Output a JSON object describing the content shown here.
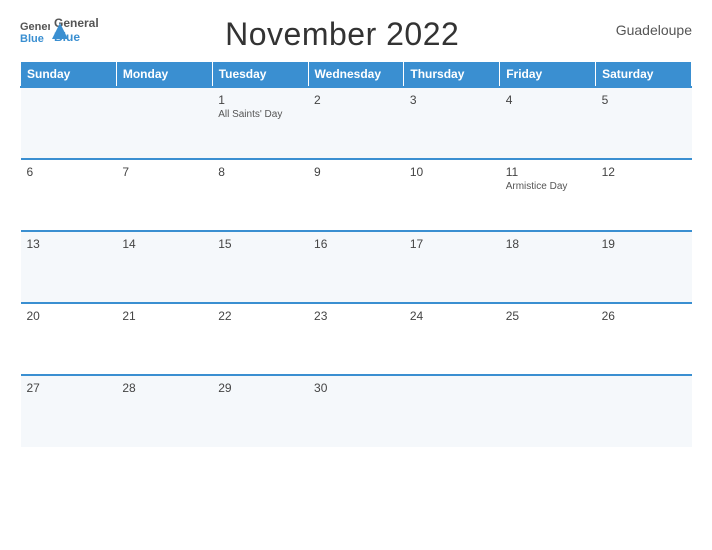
{
  "logo": {
    "line1": "General",
    "line2": "Blue"
  },
  "title": "November 2022",
  "country": "Guadeloupe",
  "days": [
    "Sunday",
    "Monday",
    "Tuesday",
    "Wednesday",
    "Thursday",
    "Friday",
    "Saturday"
  ],
  "weeks": [
    [
      {
        "date": "",
        "holiday": ""
      },
      {
        "date": "",
        "holiday": ""
      },
      {
        "date": "1",
        "holiday": "All Saints' Day"
      },
      {
        "date": "2",
        "holiday": ""
      },
      {
        "date": "3",
        "holiday": ""
      },
      {
        "date": "4",
        "holiday": ""
      },
      {
        "date": "5",
        "holiday": ""
      }
    ],
    [
      {
        "date": "6",
        "holiday": ""
      },
      {
        "date": "7",
        "holiday": ""
      },
      {
        "date": "8",
        "holiday": ""
      },
      {
        "date": "9",
        "holiday": ""
      },
      {
        "date": "10",
        "holiday": ""
      },
      {
        "date": "11",
        "holiday": "Armistice Day"
      },
      {
        "date": "12",
        "holiday": ""
      }
    ],
    [
      {
        "date": "13",
        "holiday": ""
      },
      {
        "date": "14",
        "holiday": ""
      },
      {
        "date": "15",
        "holiday": ""
      },
      {
        "date": "16",
        "holiday": ""
      },
      {
        "date": "17",
        "holiday": ""
      },
      {
        "date": "18",
        "holiday": ""
      },
      {
        "date": "19",
        "holiday": ""
      }
    ],
    [
      {
        "date": "20",
        "holiday": ""
      },
      {
        "date": "21",
        "holiday": ""
      },
      {
        "date": "22",
        "holiday": ""
      },
      {
        "date": "23",
        "holiday": ""
      },
      {
        "date": "24",
        "holiday": ""
      },
      {
        "date": "25",
        "holiday": ""
      },
      {
        "date": "26",
        "holiday": ""
      }
    ],
    [
      {
        "date": "27",
        "holiday": ""
      },
      {
        "date": "28",
        "holiday": ""
      },
      {
        "date": "29",
        "holiday": ""
      },
      {
        "date": "30",
        "holiday": ""
      },
      {
        "date": "",
        "holiday": ""
      },
      {
        "date": "",
        "holiday": ""
      },
      {
        "date": "",
        "holiday": ""
      }
    ]
  ]
}
